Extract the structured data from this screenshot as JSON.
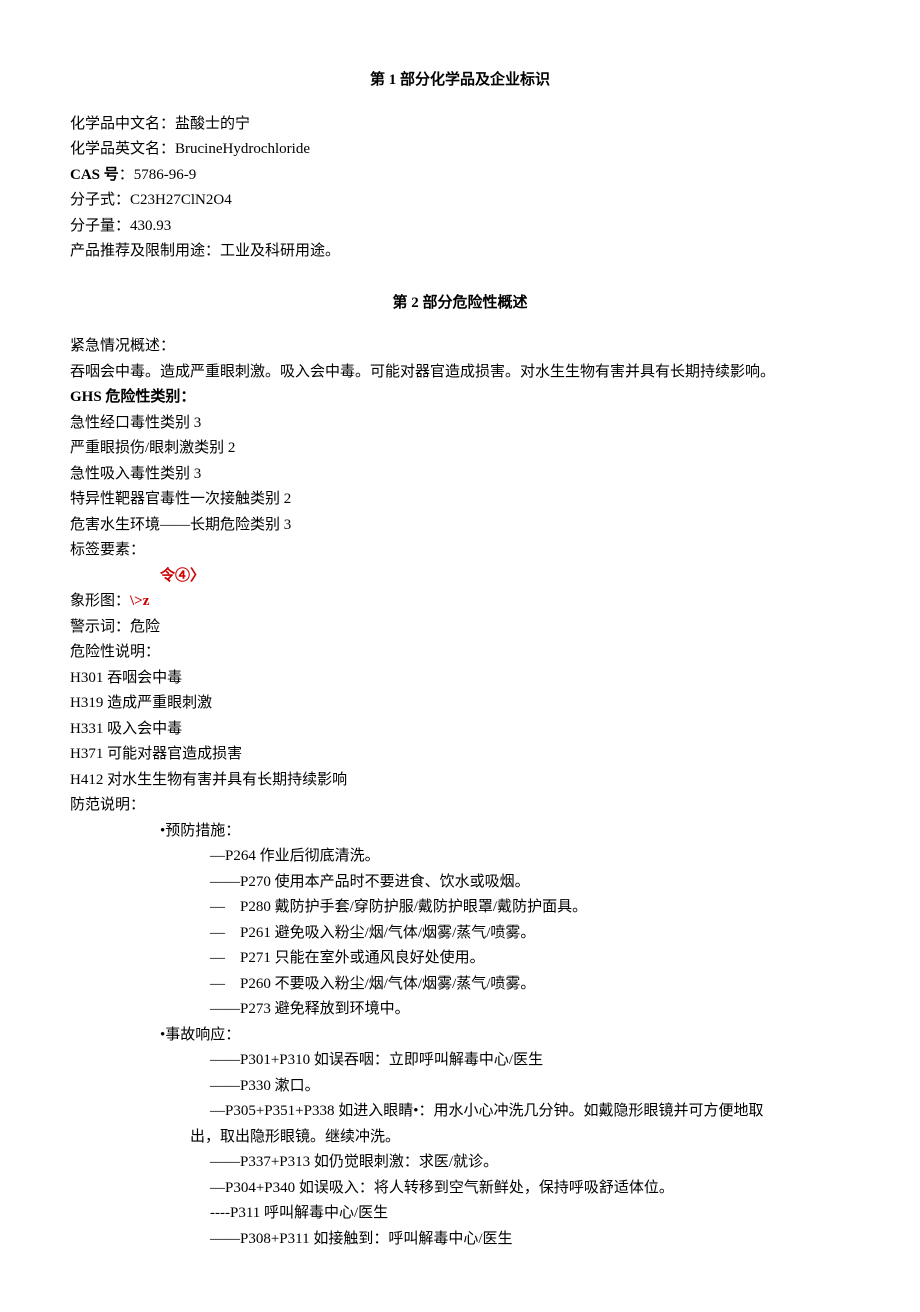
{
  "section1": {
    "title": "第 1 部分化学品及企业标识",
    "cn_name_label": "化学品中文名：",
    "cn_name": "盐酸士的宁",
    "en_name_label": "化学品英文名：",
    "en_name": "BrucineHydrochloride",
    "cas_label": "CAS 号",
    "cas_sep": "：",
    "cas": "5786-96-9",
    "formula_label": "分子式：",
    "formula": "C23H27ClN2O4",
    "mw_label": "分子量：",
    "mw": "430.93",
    "use_label": "产品推荐及限制用途：",
    "use": "工业及科研用途。"
  },
  "section2": {
    "title": "第 2 部分危险性概述",
    "emergency_label": "紧急情况概述：",
    "emergency_text": "吞咽会中毒。造成严重眼刺激。吸入会中毒。可能对器官造成损害。对水生生物有害并具有长期持续影响。",
    "ghs_label": "GHS 危险性类别：",
    "ghs_items": [
      "急性经口毒性类别 3",
      "严重眼损伤/眼刺激类别 2",
      "急性吸入毒性类别 3",
      "特异性靶器官毒性一次接触类别 2",
      "危害水生环境——长期危险类别 3"
    ],
    "label_elements": "标签要素：",
    "picto_top": "令④〉",
    "picto_label": "象形图：",
    "picto_val": "\\>z",
    "signal_label": "警示词：",
    "signal": "危险",
    "hazard_label": "危险性说明：",
    "hazard_items": [
      "H301 吞咽会中毒",
      "H319 造成严重眼刺激",
      "H331 吸入会中毒",
      "H371 可能对器官造成损害",
      "H412 对水生生物有害并具有长期持续影响"
    ],
    "precaution_label": "防范说明：",
    "prevention_label": "•预防措施：",
    "prevention_items": [
      "—P264 作业后彻底清洗。",
      "——P270 使用本产品时不要进食、饮水或吸烟。",
      "—　P280 戴防护手套/穿防护服/戴防护眼罩/戴防护面具。",
      "—　P261 避免吸入粉尘/烟/气体/烟雾/蒸气/喷雾。",
      "—　P271 只能在室外或通风良好处使用。",
      "—　P260 不要吸入粉尘/烟/气体/烟雾/蒸气/喷雾。",
      "——P273 避免释放到环境中。"
    ],
    "response_label": "•事故响应：",
    "response_items": [
      "——P301+P310 如误吞咽：立即呼叫解毒中心/医生",
      "——P330 漱口。",
      "—P305+P351+P338 如进入眼睛•：用水小心冲洗几分钟。如戴隐形眼镜并可方便地取"
    ],
    "response_cont": "出，取出隐形眼镜。继续冲洗。",
    "response_items_2": [
      "——P337+P313 如仍觉眼刺激：求医/就诊。",
      "—P304+P340 如误吸入：将人转移到空气新鲜处，保持呼吸舒适体位。",
      "----P311 呼叫解毒中心/医生",
      "——P308+P311 如接触到：呼叫解毒中心/医生"
    ]
  }
}
